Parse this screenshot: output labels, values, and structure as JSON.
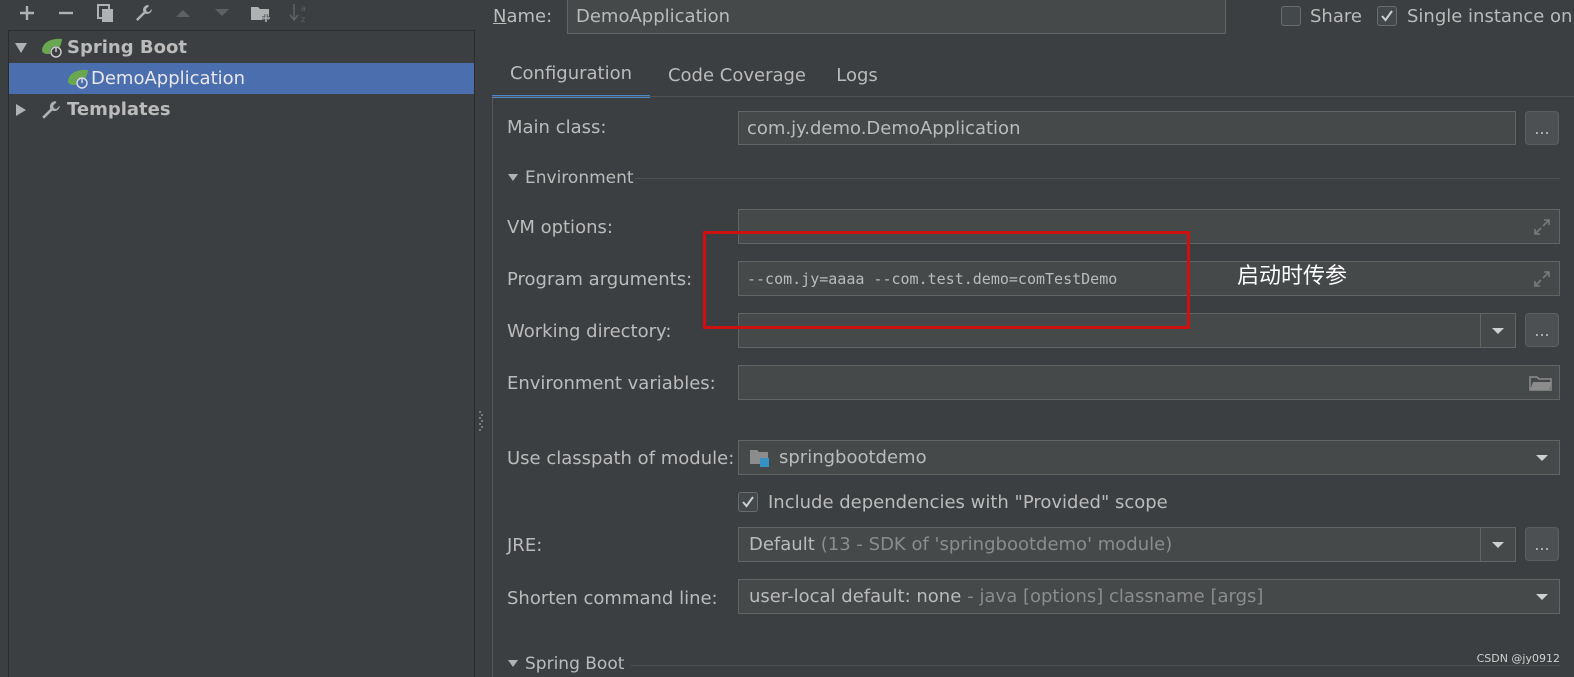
{
  "toolbar": {
    "icons": [
      "add-icon",
      "remove-icon",
      "copy-icon",
      "wrench-icon",
      "move-up-icon",
      "move-down-icon",
      "new-folder-icon",
      "sort-alphabetically-icon"
    ]
  },
  "tree": {
    "items": [
      {
        "label": "Spring Boot",
        "icon": "spring-boot-icon",
        "expanded": true
      },
      {
        "label": "DemoApplication",
        "icon": "spring-boot-run-icon",
        "selected": true
      },
      {
        "label": "Templates",
        "icon": "wrench-icon",
        "expanded": false
      }
    ]
  },
  "header": {
    "name_label": "Name:",
    "name_value": "DemoApplication",
    "share_label": "Share",
    "share_checked": false,
    "single_instance_label": "Single instance onl",
    "single_instance_checked": true
  },
  "tabs": [
    {
      "label": "Configuration",
      "active": true
    },
    {
      "label": "Code Coverage",
      "active": false
    },
    {
      "label": "Logs",
      "active": false
    }
  ],
  "config": {
    "main_class_label": "Main class:",
    "main_class_value": "com.jy.demo.DemoApplication",
    "dots_label": "...",
    "environment_section": "Environment",
    "vm_options_label": "VM options:",
    "vm_options_value": "",
    "program_args_label": "Program arguments:",
    "program_args_value": "--com.jy=aaaa --com.test.demo=comTestDemo",
    "working_dir_label": "Working directory:",
    "working_dir_value": "",
    "env_vars_label": "Environment variables:",
    "env_vars_value": "",
    "classpath_label": "Use classpath of module:",
    "classpath_value": "springbootdemo",
    "include_deps_label": "Include dependencies with \"Provided\" scope",
    "include_deps_checked": true,
    "jre_label": "JRE:",
    "jre_value": "Default",
    "jre_detail": "(13 - SDK of 'springbootdemo' module)",
    "shorten_label": "Shorten command line:",
    "shorten_value": "user-local default: none",
    "shorten_detail": "- java [options] classname [args]",
    "spring_boot_section": "Spring Boot"
  },
  "annotation": {
    "text": "启动时传参",
    "box_color": "#d01010"
  },
  "watermark": "CSDN @jy0912",
  "colors": {
    "background": "#3c3f41",
    "selection": "#4b6eaf",
    "field": "#45494a",
    "accent_tab": "#4a88c7",
    "text": "#bbbbbb"
  }
}
